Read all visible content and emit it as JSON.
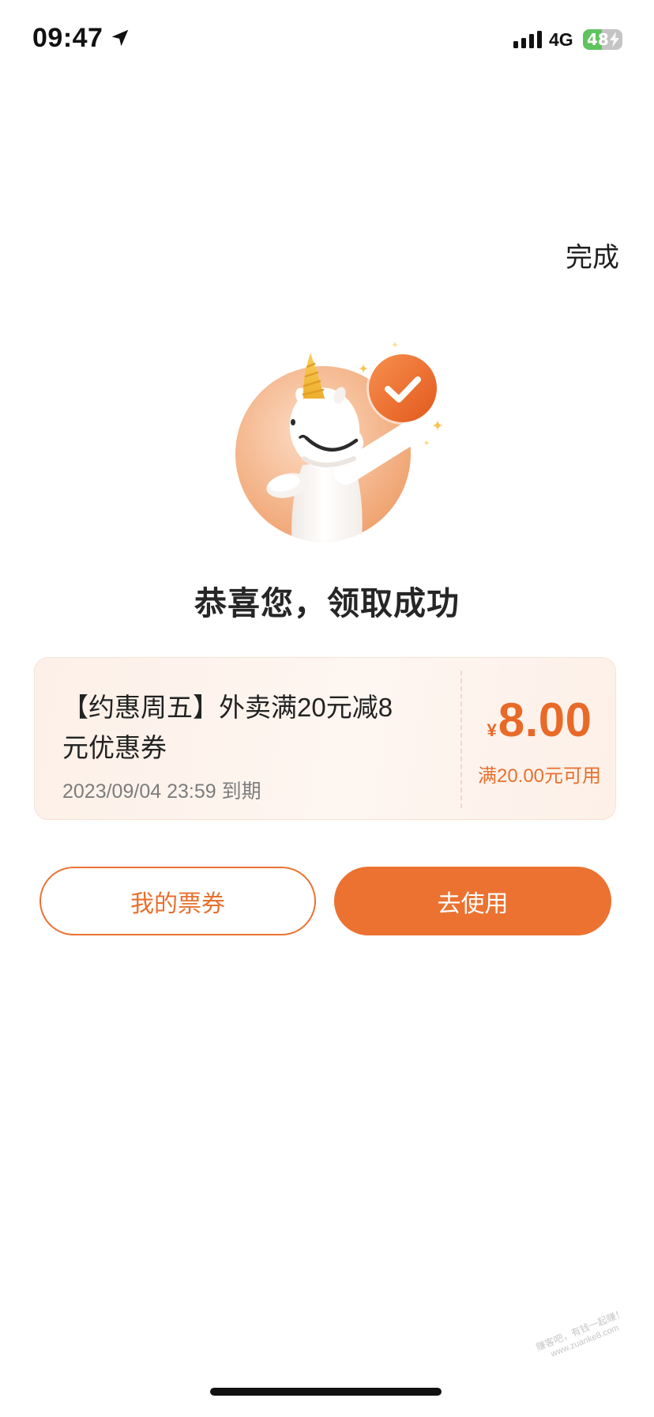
{
  "status_bar": {
    "time": "09:47",
    "location_icon": "location-arrow-icon",
    "signal_icon": "signal-bars-icon",
    "network": "4G",
    "battery_level": "48",
    "battery_charging": true
  },
  "header": {
    "done_label": "完成"
  },
  "illustration": {
    "mascot_icon": "unicorn-mascot-icon",
    "badge_icon": "check-badge-icon"
  },
  "title": "恭喜您，领取成功",
  "coupon": {
    "name_lines": [
      "【约惠周五】外卖满20元减8",
      "元优惠券"
    ],
    "expiry": "2023/09/04 23:59 到期",
    "currency_symbol": "¥",
    "amount": "8.00",
    "condition": "满20.00元可用"
  },
  "actions": {
    "my_tickets_label": "我的票券",
    "use_label": "去使用"
  },
  "watermark": {
    "line1": "赚客吧，有钱一起赚！",
    "line2": "www.zuanke8.com"
  },
  "colors": {
    "accent": "#EC7231",
    "price": "#E86A28",
    "text_primary": "#222222",
    "text_secondary": "#7D7D7D",
    "coupon_background": "#FDF0E8",
    "battery_charging": "#5FC45E"
  }
}
